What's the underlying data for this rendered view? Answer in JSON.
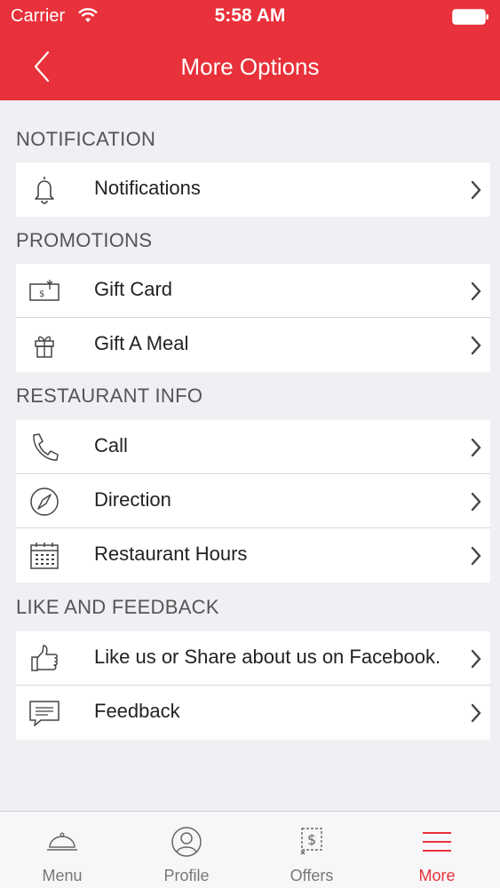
{
  "status_bar": {
    "carrier": "Carrier",
    "time": "5:58 AM"
  },
  "nav": {
    "title": "More Options"
  },
  "sections": [
    {
      "header": "NOTIFICATION",
      "rows": [
        {
          "label": "Notifications",
          "icon": "bell-icon"
        }
      ]
    },
    {
      "header": "PROMOTIONS",
      "rows": [
        {
          "label": "Gift Card",
          "icon": "gift-card-icon"
        },
        {
          "label": "Gift A Meal",
          "icon": "gift-icon"
        }
      ]
    },
    {
      "header": "RESTAURANT INFO",
      "rows": [
        {
          "label": "Call",
          "icon": "phone-icon"
        },
        {
          "label": "Direction",
          "icon": "compass-icon"
        },
        {
          "label": "Restaurant Hours",
          "icon": "calendar-icon"
        }
      ]
    },
    {
      "header": "LIKE AND FEEDBACK",
      "rows": [
        {
          "label": "Like us or Share about us on Facebook.",
          "icon": "thumbs-up-icon"
        },
        {
          "label": "Feedback",
          "icon": "chat-bubble-icon"
        }
      ]
    }
  ],
  "tabs": [
    {
      "label": "Menu",
      "icon": "cloche-icon",
      "active": false
    },
    {
      "label": "Profile",
      "icon": "profile-icon",
      "active": false
    },
    {
      "label": "Offers",
      "icon": "coupon-icon",
      "active": false
    },
    {
      "label": "More",
      "icon": "hamburger-icon",
      "active": true
    }
  ],
  "colors": {
    "accent": "#e8313a",
    "background": "#efeff4"
  }
}
